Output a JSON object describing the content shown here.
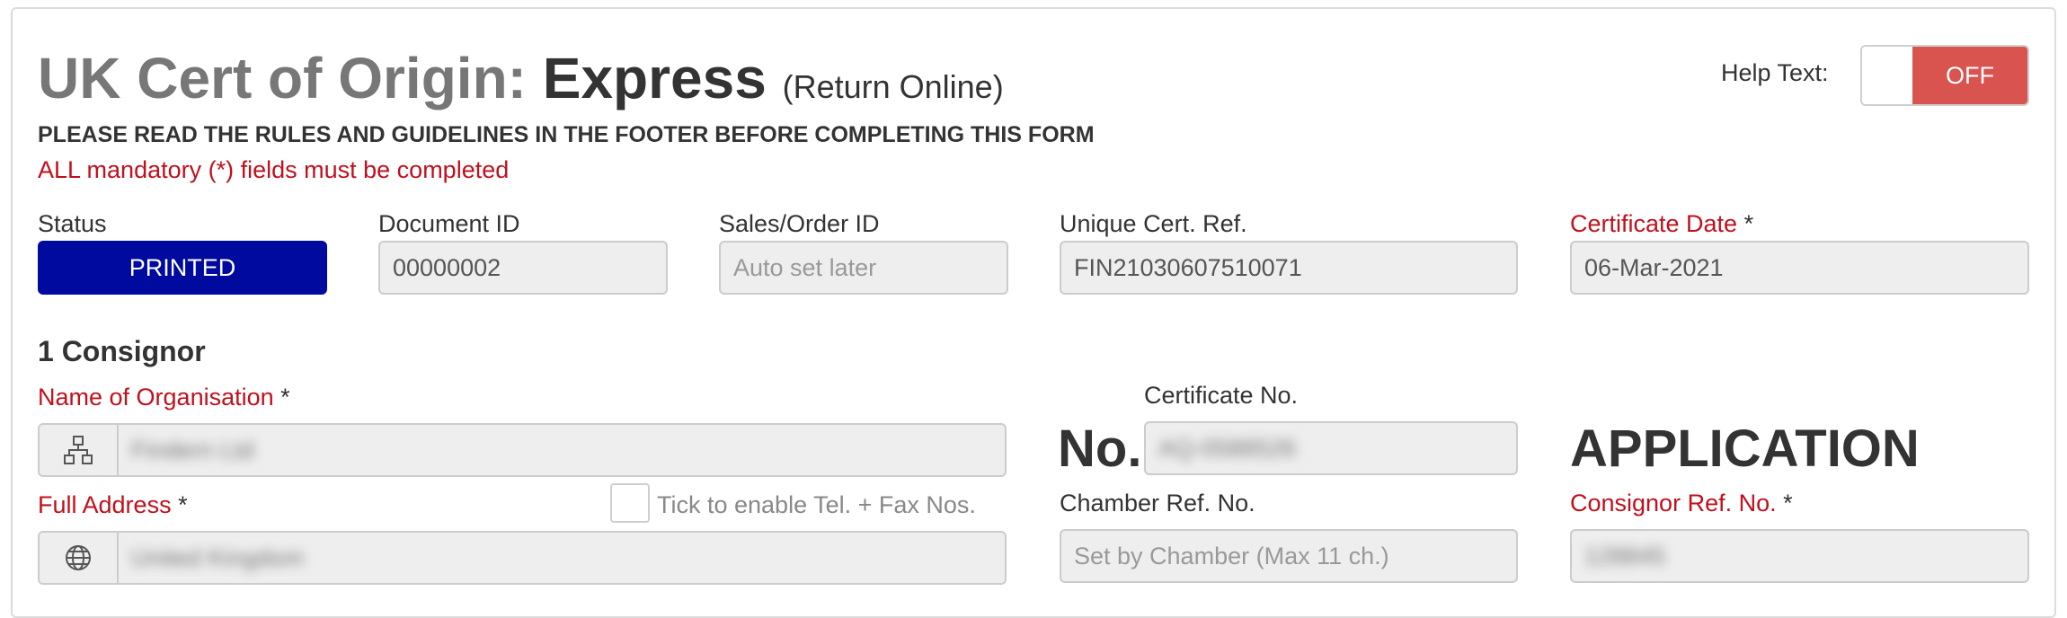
{
  "header": {
    "title_prefix": "UK Cert of Origin: ",
    "title_strong": "Express",
    "title_suffix": "(Return Online)",
    "rules_notice": "PLEASE READ THE RULES AND GUIDELINES IN THE FOOTER BEFORE COMPLETING THIS FORM",
    "mandatory_notice": "ALL mandatory (*) fields must be completed"
  },
  "help_toggle": {
    "label": "Help Text:",
    "state_label": "OFF",
    "state": "off",
    "off_color": "#d9534f"
  },
  "top_fields": {
    "status": {
      "label": "Status",
      "value": "PRINTED",
      "color": "#000a9e"
    },
    "document_id": {
      "label": "Document ID",
      "value": "00000002"
    },
    "sales_order_id": {
      "label": "Sales/Order ID",
      "placeholder": "Auto set later"
    },
    "unique_cert_ref": {
      "label": "Unique Cert. Ref.",
      "value": "FIN21030607510071"
    },
    "certificate_date": {
      "label": "Certificate Date",
      "required_mark": "*",
      "value": "06-Mar-2021"
    }
  },
  "consignor": {
    "section_title": "1 Consignor",
    "organisation": {
      "label": "Name of Organisation",
      "required_mark": "*",
      "value": "Findern Ltd",
      "icon": "organisation-icon"
    },
    "address": {
      "label": "Full Address",
      "required_mark": "*",
      "value": "United Kingdom",
      "icon": "globe-icon"
    },
    "tel_fax_toggle_label": "Tick to enable Tel. + Fax Nos.",
    "tel_fax_checked": false
  },
  "certificate": {
    "no_heading": "No.",
    "certificate_no": {
      "label": "Certificate No.",
      "value": "AQ-0588526"
    },
    "chamber_ref": {
      "label": "Chamber Ref. No.",
      "placeholder": "Set by Chamber (Max 11 ch.)"
    },
    "application_heading": "APPLICATION",
    "consignor_ref": {
      "label": "Consignor Ref. No.",
      "required_mark": "*",
      "value": "128845"
    }
  },
  "colors": {
    "required_red": "#c0101d",
    "status_blue": "#000a9e",
    "field_bg": "#eeeeee"
  }
}
